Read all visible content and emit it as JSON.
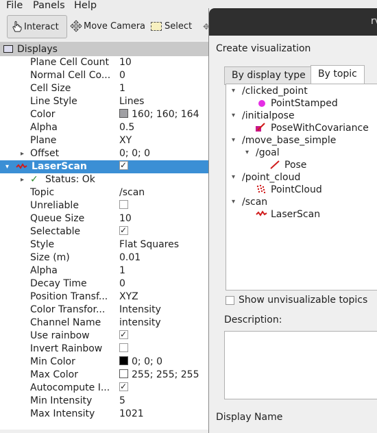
{
  "menu": [
    "File",
    "Panels",
    "Help"
  ],
  "toolbar": {
    "interact": "Interact",
    "move_camera": "Move Camera",
    "select": "Select"
  },
  "displays": {
    "title": "Displays"
  },
  "grid_props": [
    {
      "label": "Plane Cell Count",
      "value": "10"
    },
    {
      "label": "Normal Cell Co...",
      "value": "0"
    },
    {
      "label": "Cell Size",
      "value": "1"
    },
    {
      "label": "Line Style",
      "value": "Lines"
    },
    {
      "label": "Color",
      "value": "160; 160; 164",
      "swatch": "#a0a0a4"
    },
    {
      "label": "Alpha",
      "value": "0.5"
    },
    {
      "label": "Plane",
      "value": "XY"
    },
    {
      "label": "Offset",
      "value": "0; 0; 0"
    }
  ],
  "laserscan": {
    "label": "LaserScan",
    "status": "Status: Ok",
    "props": [
      {
        "label": "Topic",
        "value": "/scan"
      },
      {
        "label": "Unreliable",
        "check": false
      },
      {
        "label": "Queue Size",
        "value": "10"
      },
      {
        "label": "Selectable",
        "check": true
      },
      {
        "label": "Style",
        "value": "Flat Squares"
      },
      {
        "label": "Size (m)",
        "value": "0.01"
      },
      {
        "label": "Alpha",
        "value": "1"
      },
      {
        "label": "Decay Time",
        "value": "0"
      },
      {
        "label": "Position Transf...",
        "value": "XYZ"
      },
      {
        "label": "Color Transfor...",
        "value": "Intensity"
      },
      {
        "label": "Channel Name",
        "value": "intensity"
      },
      {
        "label": "Use rainbow",
        "check": true
      },
      {
        "label": "Invert Rainbow",
        "check": false
      },
      {
        "label": "Min Color",
        "value": "0; 0; 0",
        "swatch": "#000000"
      },
      {
        "label": "Max Color",
        "value": "255; 255; 255",
        "swatch": "#ffffff"
      },
      {
        "label": "Autocompute I...",
        "check": true
      },
      {
        "label": "Min Intensity",
        "value": "5"
      },
      {
        "label": "Max Intensity",
        "value": "1021"
      }
    ]
  },
  "dialog": {
    "title_fragment": "rv",
    "heading": "Create visualization",
    "tab_display_type": "By display type",
    "tab_topic": "By topic",
    "topics": {
      "clicked_point": "/clicked_point",
      "point_stamped": "PointStamped",
      "initialpose": "/initialpose",
      "pose_cov": "PoseWithCovariance",
      "move_base_simple": "/move_base_simple",
      "goal": "/goal",
      "pose": "Pose",
      "point_cloud": "/point_cloud",
      "pointcloud": "PointCloud",
      "scan": "/scan",
      "laserscan": "LaserScan"
    },
    "show_unvis": "Show unvisualizable topics",
    "description_label": "Description:",
    "display_name_label": "Display Name"
  },
  "colors": {
    "selection": "#3b8fd5",
    "scan_red": "#d01c1c",
    "magenta": "#e52ee5"
  }
}
